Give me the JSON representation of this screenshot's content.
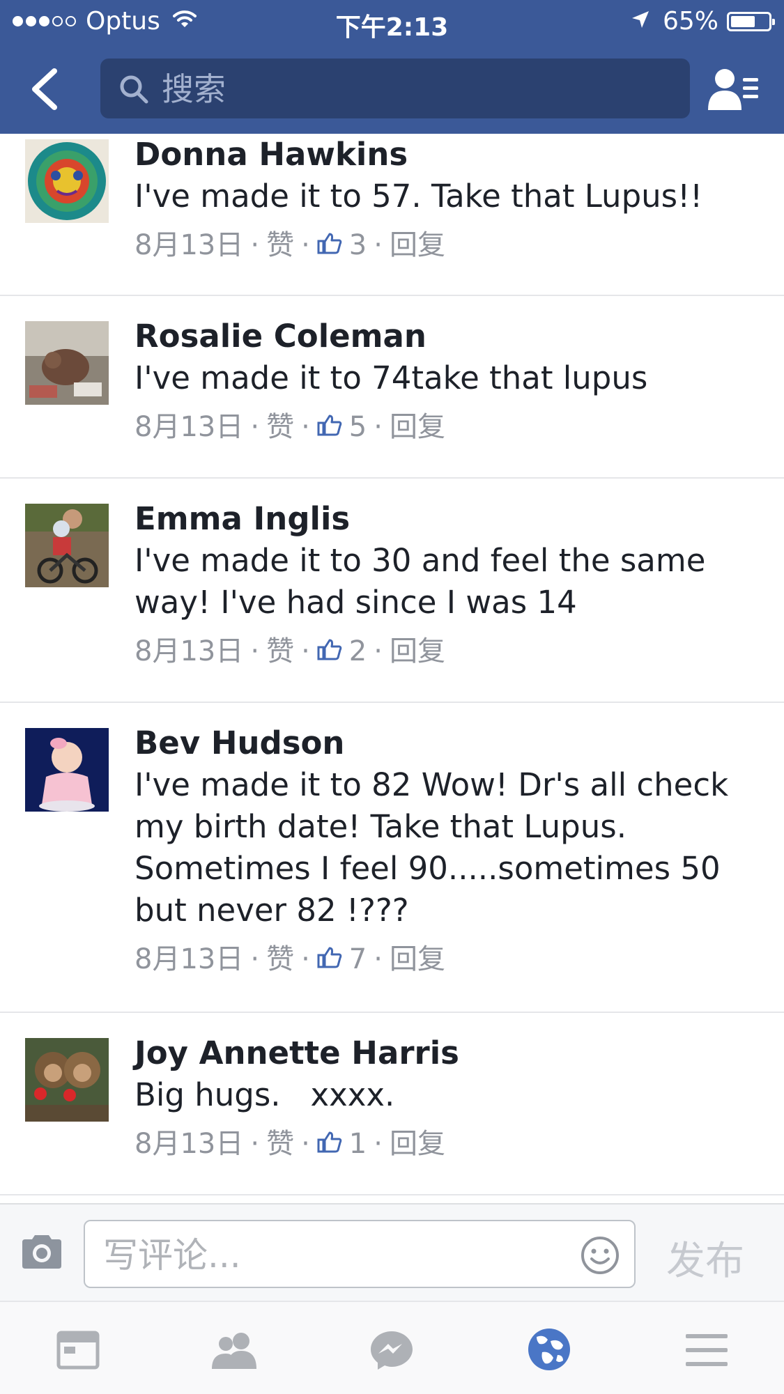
{
  "status_bar": {
    "carrier": "Optus",
    "time": "下午2:13",
    "battery": "65%",
    "battery_level": 0.65
  },
  "nav": {
    "search_placeholder": "搜索"
  },
  "comments": [
    {
      "name": "Donna Hawkins",
      "text": "I've made it to 57. Take that Lupus!!",
      "date": "8月13日",
      "like": "赞",
      "likes": "3",
      "reply": "回复"
    },
    {
      "name": "Rosalie Coleman",
      "text": "I've made it to 74take that lupus",
      "date": "8月13日",
      "like": "赞",
      "likes": "5",
      "reply": "回复"
    },
    {
      "name": "Emma Inglis",
      "text": "I've made it to 30 and feel the same way! I've had since I was 14",
      "date": "8月13日",
      "like": "赞",
      "likes": "2",
      "reply": "回复"
    },
    {
      "name": "Bev Hudson",
      "text": "I've made it to 82 Wow! Dr's all check my birth date! Take that Lupus. Sometimes I feel 90.....sometimes 50 but never 82 !???",
      "date": "8月13日",
      "like": "赞",
      "likes": "7",
      "reply": "回复"
    },
    {
      "name": "Joy Annette Harris",
      "text": "Big hugs.   xxxx.",
      "date": "8月13日",
      "like": "赞",
      "likes": "1",
      "reply": "回复"
    }
  ],
  "composer": {
    "placeholder": "写评论...",
    "post_label": "发布"
  },
  "tabs": [
    {
      "icon": "news-feed-icon"
    },
    {
      "icon": "friend-requests-icon"
    },
    {
      "icon": "messenger-icon"
    },
    {
      "icon": "notifications-globe-icon",
      "active": true
    },
    {
      "icon": "menu-icon"
    }
  ],
  "colors": {
    "brand": "#3b5998",
    "search_bg": "#2b4170",
    "meta_text": "#90949c",
    "active_tab": "#4a76c6",
    "inactive_tab": "#aeb1b6"
  }
}
